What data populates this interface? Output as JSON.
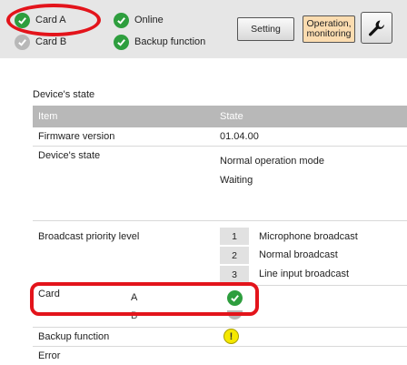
{
  "topbar": {
    "status": {
      "card_a": "Card A",
      "card_b": "Card B",
      "online": "Online",
      "backup": "Backup function"
    },
    "setting_label": "Setting",
    "operation_label_1": "Operation,",
    "operation_label_2": "monitoring",
    "tool_icon": "wrench-icon",
    "colors": {
      "ok": "#2e9e3e",
      "inactive": "#b8b8b8",
      "active_tab": "#fbdcb0",
      "highlight": "#e3141b"
    }
  },
  "main": {
    "section_title": "Device's state",
    "columns": {
      "item": "Item",
      "state": "State"
    },
    "rows": {
      "firmware_label": "Firmware version",
      "firmware_value": "01.04.00",
      "state_label": "Device's state",
      "state_mode": "Normal operation mode",
      "state_status": "Waiting",
      "priority_label": "Broadcast priority level",
      "priorities": [
        {
          "num": "1",
          "name": "Microphone broadcast"
        },
        {
          "num": "2",
          "name": "Normal broadcast"
        },
        {
          "num": "3",
          "name": "Line input broadcast"
        }
      ],
      "card_label": "Card",
      "card_a": "A",
      "card_b": "B",
      "backup_label": "Backup function",
      "error_label": "Error"
    }
  }
}
